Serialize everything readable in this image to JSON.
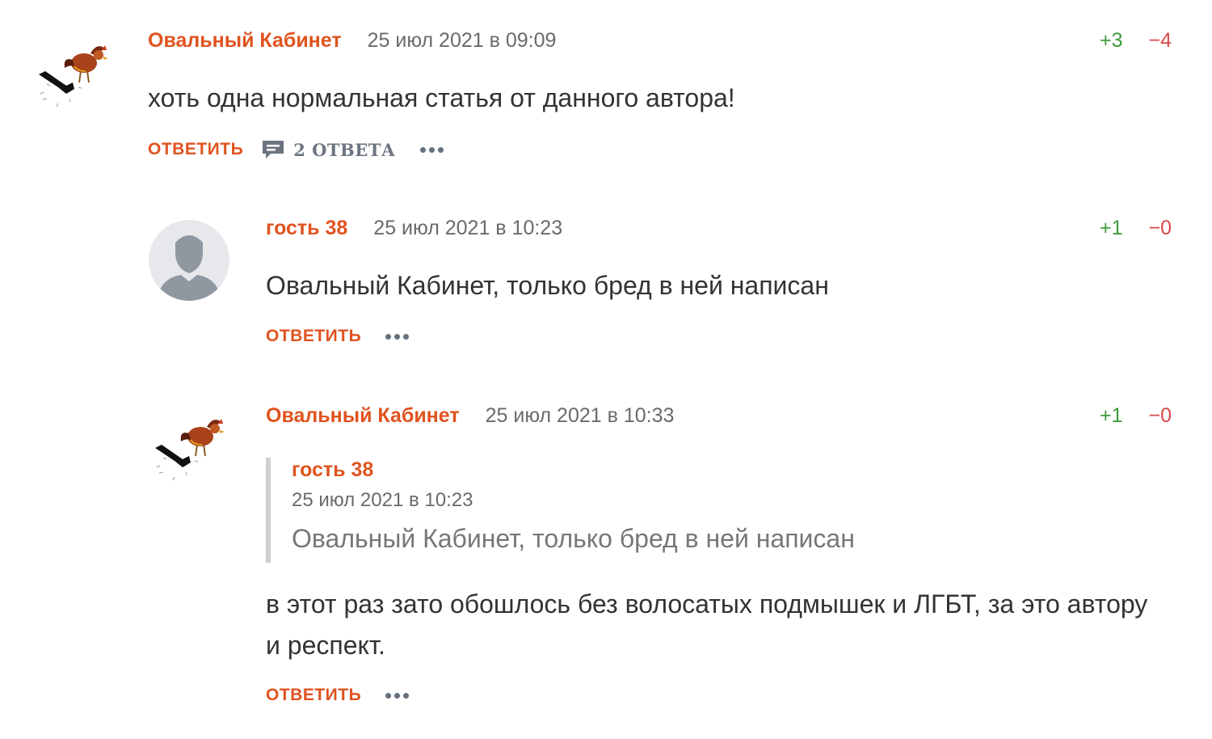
{
  "comments": [
    {
      "author": "Овальный Кабинет",
      "date": "25 июл 2021 в 09:09",
      "votes_up": "+3",
      "votes_down": "−4",
      "text": "хоть одна нормальная статья от данного автора!",
      "reply_label": "ОТВЕТИТЬ",
      "answers_label": "2 ОТВЕТА",
      "avatar": "rooster-avatar-icon"
    },
    {
      "author": "гость 38",
      "date": "25 июл 2021 в 10:23",
      "votes_up": "+1",
      "votes_down": "−0",
      "text": "Овальный Кабинет, только бред в ней написан",
      "reply_label": "ОТВЕТИТЬ",
      "avatar": "default-user-icon"
    },
    {
      "author": "Овальный Кабинет",
      "date": "25 июл 2021 в 10:33",
      "votes_up": "+1",
      "votes_down": "−0",
      "quote": {
        "author": "гость 38",
        "date": "25 июл 2021 в 10:23",
        "text": "Овальный Кабинет, только бред в ней написан"
      },
      "text": "в этот раз зато обошлось без волосатых подмышек и ЛГБТ, за это автору и респект.",
      "reply_label": "ОТВЕТИТЬ",
      "avatar": "rooster-avatar-icon"
    }
  ],
  "colors": {
    "accent": "#e0531f",
    "vote_up": "#3e9b3e",
    "vote_down": "#d8484a",
    "text": "#333333",
    "muted": "#6a6a6a"
  }
}
